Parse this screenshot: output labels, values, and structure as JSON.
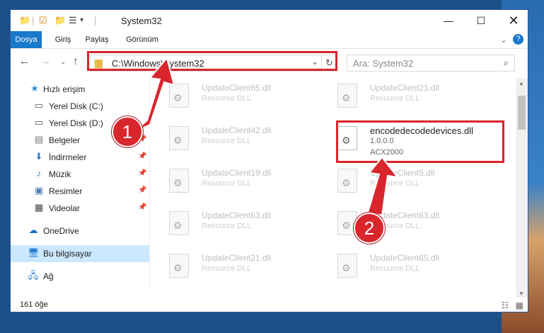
{
  "window": {
    "title": "System32"
  },
  "ribbon": {
    "tabs": [
      "Dosya",
      "Giriş",
      "Paylaş",
      "Görünüm"
    ]
  },
  "address": {
    "path": "C:\\Windows\\System32"
  },
  "search": {
    "placeholder": "Ara: System32"
  },
  "sidebar": {
    "items": [
      {
        "label": "Hızlı erişim",
        "icon": "star-icon"
      },
      {
        "label": "Yerel Disk (C:)",
        "icon": "drive-icon"
      },
      {
        "label": "Yerel Disk (D:)",
        "icon": "drive-icon"
      },
      {
        "label": "Belgeler",
        "icon": "documents-icon"
      },
      {
        "label": "İndirmeler",
        "icon": "download-icon"
      },
      {
        "label": "Müzik",
        "icon": "music-icon"
      },
      {
        "label": "Resimler",
        "icon": "pictures-icon"
      },
      {
        "label": "Videolar",
        "icon": "videos-icon"
      },
      {
        "label": "OneDrive",
        "icon": "cloud-icon"
      },
      {
        "label": "Bu bilgisayar",
        "icon": "computer-icon"
      },
      {
        "label": "Ağ",
        "icon": "network-icon"
      }
    ]
  },
  "files": [
    {
      "name": "UpdateClient65.dll",
      "type": "Resource DLL"
    },
    {
      "name": "UpdateClient21.dll",
      "type": "Resource DLL"
    },
    {
      "name": "UpdateClient42.dll",
      "type": "Resource DLL"
    },
    {
      "name": "encodedecodedevices.dll",
      "version": "1.0.0.0",
      "company": "ACX2000"
    },
    {
      "name": "UpdateClient19.dll",
      "type": "Resource DLL"
    },
    {
      "name": "UpdateClient5.dll",
      "type": "Resource DLL"
    },
    {
      "name": "UpdateClient63.dll",
      "type": "Resource DLL"
    },
    {
      "name": "UpdateClient63.dll",
      "type": "Resource DLL"
    },
    {
      "name": "UpdateClient21.dll",
      "type": "Resource DLL"
    },
    {
      "name": "UpdateClient65.dll",
      "type": "Resource DLL"
    }
  ],
  "status": {
    "count": "161 öğe"
  },
  "callouts": {
    "one": "1",
    "two": "2"
  },
  "colors": {
    "accent": "#1979ca",
    "highlight": "#d9252c",
    "selected": "#cce8ff"
  }
}
